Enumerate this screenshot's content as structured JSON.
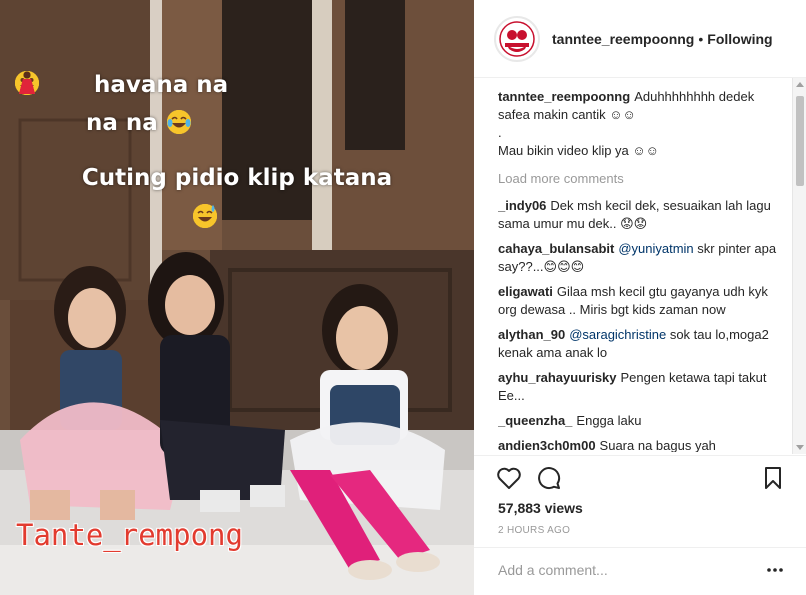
{
  "post": {
    "username": "tanntee_reempoonng",
    "separator": "•",
    "follow_status": "Following"
  },
  "media": {
    "caption_line1": "havana na",
    "caption_line2": "na na",
    "caption_line3": "Cuting pidio klip katana",
    "watermark": "Tante_rempong"
  },
  "caption": {
    "username": "tanntee_reempoonng",
    "text_line1": "Aduhhhhhhhh dedek safea makin cantik ☺☺",
    "text_line2": ".",
    "text_line3": "Mau bikin video klip ya ☺☺"
  },
  "load_more": "Load more comments",
  "comments": [
    {
      "username": "_indy06",
      "text": "Dek msh kecil dek, sesuaikan lah lagu sama umur mu dek.. 😟😟"
    },
    {
      "username": "cahaya_bulansabit",
      "mention": "@yuniyatmin",
      "text": " skr pinter apa say??...😊😊😊"
    },
    {
      "username": "eligawati",
      "text": "Gilaa msh kecil gtu gayanya udh kyk org dewasa .. Miris bgt kids zaman now"
    },
    {
      "username": "alythan_90",
      "mention": "@saragichristine",
      "text": " sok tau lo,moga2 kenak ama anak lo"
    },
    {
      "username": "ayhu_rahayuurisky",
      "text": "Pengen ketawa tapi takut Ee..."
    },
    {
      "username": "_queenzha_",
      "text": "Engga laku"
    },
    {
      "username": "andien3ch0m00",
      "text": "Suara na bagus yah"
    }
  ],
  "stats": {
    "views": "57,883 views",
    "time_ago": "2 HOURS AGO"
  },
  "add_comment": {
    "placeholder": "Add a comment..."
  },
  "icons": {
    "like": "heart-icon",
    "comment": "comment-bubble-icon",
    "save": "bookmark-icon",
    "more": "more-options-icon"
  }
}
